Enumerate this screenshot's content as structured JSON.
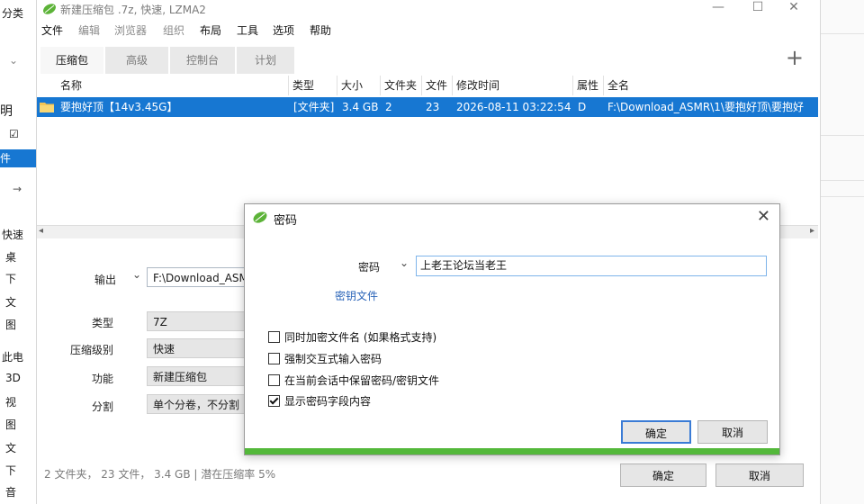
{
  "background": {
    "left_items": [
      "分类",
      "明",
      "件",
      "→",
      "快速",
      "桌",
      "下",
      "文",
      "图",
      "此电",
      "3D",
      "视",
      "图",
      "文",
      "下",
      "音"
    ]
  },
  "window": {
    "title": "新建压缩包 .7z, 快速, LZMA2",
    "controls": {
      "minimize": "—",
      "maximize": "☐",
      "close": "✕"
    }
  },
  "menu": [
    {
      "label": "文件",
      "dim": false
    },
    {
      "label": "编辑",
      "dim": true
    },
    {
      "label": "浏览器",
      "dim": true
    },
    {
      "label": "组织",
      "dim": true
    },
    {
      "label": "布局",
      "dim": false
    },
    {
      "label": "工具",
      "dim": false
    },
    {
      "label": "选项",
      "dim": false
    },
    {
      "label": "帮助",
      "dim": false
    }
  ],
  "tabs": [
    "压缩包",
    "高级",
    "控制台",
    "计划"
  ],
  "plus": "+",
  "file_list": {
    "columns": [
      "名称",
      "类型",
      "大小",
      "文件夹",
      "文件",
      "修改时间",
      "属性",
      "全名"
    ],
    "rows": [
      {
        "name": "要抱好顶【14v3.45G】",
        "type": "[文件夹]",
        "size": "3.4 GB",
        "folders": "2",
        "files": "23",
        "modified": "2026-08-11 03:22:54",
        "attr": "D",
        "fullname": "F:\\Download_ASMR\\1\\要抱好顶\\要抱好"
      }
    ]
  },
  "form": {
    "output_label": "输出",
    "output_value": "F:\\Download_ASM",
    "type_label": "类型",
    "type_value": "7Z",
    "level_label": "压缩级别",
    "level_value": "快速",
    "function_label": "功能",
    "function_value": "新建压缩包",
    "split_label": "分割",
    "split_value": "单个分卷，不分割"
  },
  "status": "2 文件夹，  23 文件，  3.4 GB | 潜在压缩率 5%",
  "main_buttons": {
    "ok": "确定",
    "cancel": "取消"
  },
  "dialog": {
    "title": "密码",
    "close": "✕",
    "password_label": "密码",
    "password_value": "上老王论坛当老王",
    "keyfile_link": "密钥文件",
    "options": [
      {
        "label": "同时加密文件名 (如果格式支持)",
        "checked": false
      },
      {
        "label": "强制交互式输入密码",
        "checked": false
      },
      {
        "label": "在当前会话中保留密码/密钥文件",
        "checked": false
      },
      {
        "label": "显示密码字段内容",
        "checked": true
      }
    ],
    "ok": "确定",
    "cancel": "取消"
  },
  "colors": {
    "accent": "#1777d2",
    "progress_green": "#53b83a",
    "leaf_green": "#5cb338"
  }
}
